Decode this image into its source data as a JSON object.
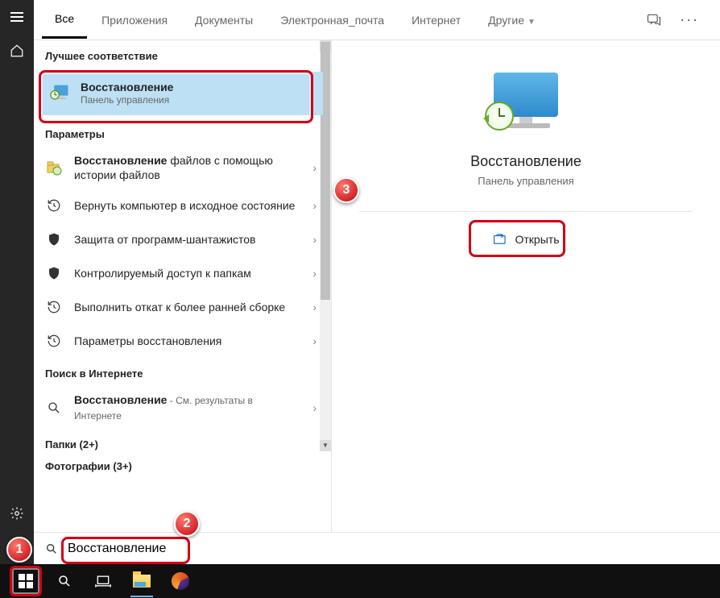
{
  "tabs": {
    "all": "Все",
    "apps": "Приложения",
    "docs": "Документы",
    "email": "Электронная_почта",
    "internet": "Интернет",
    "other": "Другие"
  },
  "sections": {
    "best_match": "Лучшее соответствие",
    "params": "Параметры",
    "web_search": "Поиск в Интернете",
    "folders": "Папки (2+)",
    "photos": "Фотографии (3+)"
  },
  "best": {
    "title": "Восстановление",
    "sub": "Панель управления"
  },
  "items": [
    {
      "strong": "Восстановление",
      "rest": " файлов с помощью истории файлов"
    },
    {
      "text": "Вернуть компьютер в исходное состояние"
    },
    {
      "text": "Защита от программ-шантажистов"
    },
    {
      "text": "Контролируемый доступ к папкам"
    },
    {
      "text": "Выполнить откат к более ранней сборке"
    },
    {
      "text": "Параметры восстановления"
    }
  ],
  "web": {
    "strong": "Восстановление",
    "rest": " - См. результаты в Интернете"
  },
  "details": {
    "title": "Восстановление",
    "sub": "Панель управления",
    "open": "Открыть"
  },
  "search": {
    "value": "Восстановление"
  },
  "callouts": {
    "c1": "1",
    "c2": "2",
    "c3": "3"
  }
}
